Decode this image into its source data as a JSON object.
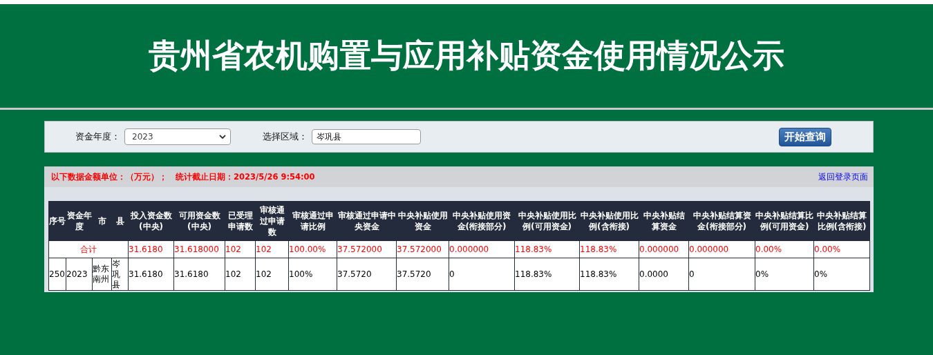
{
  "header": {
    "title": "贵州省农机购置与应用补贴资金使用情况公示"
  },
  "filters": [
    {
      "label": "资金年度：",
      "kind": "select",
      "value": "2023"
    },
    {
      "label": "选择区域：",
      "kind": "text",
      "value": "岑巩县"
    }
  ],
  "query_button": "开始查询",
  "notice": {
    "unit_text": "以下数据金额单位：（万元）；",
    "date_text": "统计截止日期：2023/5/26 9:54:00"
  },
  "back_link": "返回登录页面",
  "table": {
    "columns": [
      "序号",
      "资金年度",
      "市",
      "县",
      "投入资金数(中央)",
      "可用资金数(中央)",
      "已受理申请数",
      "审核通过申请数",
      "审核通过申请比例",
      "审核通过申请中央资金",
      "中央补贴使用资金",
      "中央补贴使用资金(衔接部分)",
      "中央补贴使用比例(可用资金)",
      "中央补贴使用比例(含衔接)",
      "中央补贴结算资金",
      "中央补贴结算资金(衔接部分)",
      "中央补贴结算比例(可用资金)",
      "中央补贴结算比例(含衔接)"
    ],
    "total_row": {
      "label": "合计",
      "values": [
        "31.6180",
        "31.618000",
        "102",
        "102",
        "100.00%",
        "37.572000",
        "37.572000",
        "0.000000",
        "118.83%",
        "118.83%",
        "0.000000",
        "0.000000",
        "0.00%",
        "0.00%"
      ]
    },
    "rows": [
      {
        "cells": [
          "250",
          "2023",
          "黔东南州",
          "岑巩县",
          "31.6180",
          "31.6180",
          "102",
          "102",
          "100%",
          "37.5720",
          "37.5720",
          "0",
          "118.83%",
          "118.83%",
          "0.0000",
          "0",
          "0%",
          "0%"
        ]
      }
    ]
  }
}
